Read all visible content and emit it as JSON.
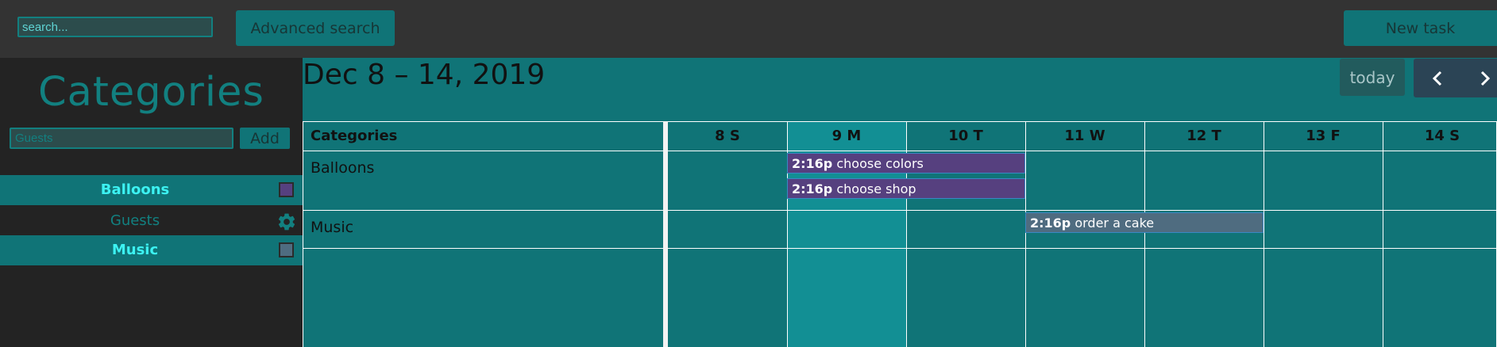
{
  "topbar": {
    "search_placeholder": "search...",
    "advanced_search_label": "Advanced search",
    "new_task_label": "New task"
  },
  "sidebar": {
    "title": "Categories",
    "input_placeholder": "Guests",
    "add_label": "Add",
    "items": [
      {
        "label": "Balloons",
        "control": "color-swatch",
        "color": "#56407f",
        "selected": true
      },
      {
        "label": "Guests",
        "control": "gear-icon",
        "selected": false
      },
      {
        "label": "Music",
        "control": "color-swatch",
        "color": "#4f6c80",
        "selected": true
      }
    ]
  },
  "calendar": {
    "title": "Dec 8 – 14, 2019",
    "today_label": "today",
    "prev_icon": "chevron-left-icon",
    "next_icon": "chevron-right-icon",
    "resource_header": "Categories",
    "days": [
      "8 S",
      "9 M",
      "10 T",
      "11 W",
      "12 T",
      "13 F",
      "14 S"
    ],
    "today_day": "9 M",
    "resources": [
      "Balloons",
      "Music"
    ],
    "events": [
      {
        "time": "2:16p",
        "title": "choose colors",
        "resource": "Balloons",
        "start_day": "9 M",
        "end_day": "11 W",
        "color": "#56407f"
      },
      {
        "time": "2:16p",
        "title": "choose shop",
        "resource": "Balloons",
        "start_day": "9 M",
        "end_day": "11 W",
        "color": "#56407f"
      },
      {
        "time": "2:16p",
        "title": "order a cake",
        "resource": "Music",
        "start_day": "11 W",
        "end_day": "13 F",
        "color": "#4f6c80"
      }
    ]
  },
  "colors": {
    "accent": "#107477",
    "bright_accent": "#3cf2f2",
    "topbar_bg": "#333333",
    "sidebar_bg": "#232323"
  }
}
